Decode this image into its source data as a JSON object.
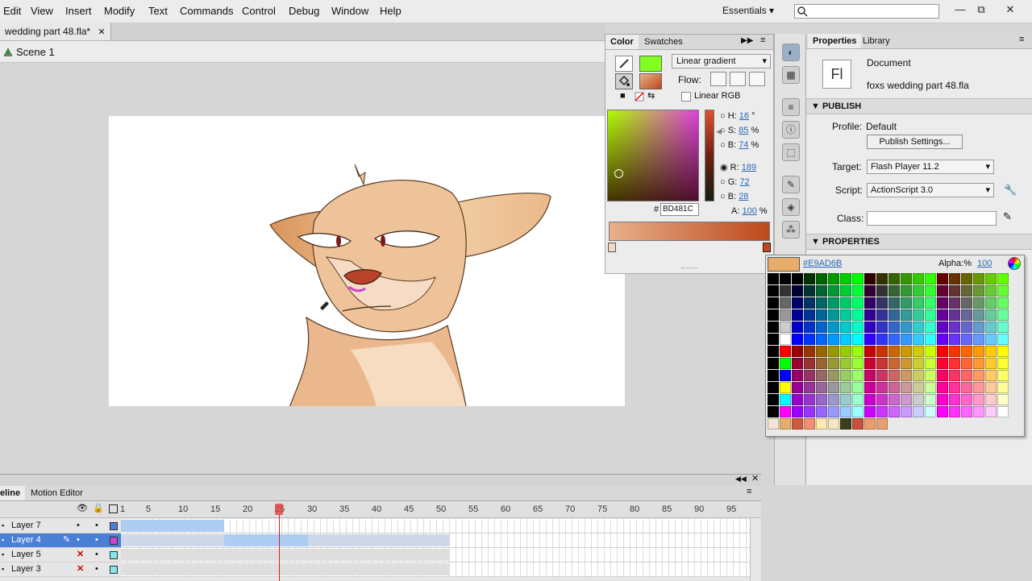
{
  "menu": {
    "items": [
      "Edit",
      "View",
      "Insert",
      "Modify",
      "Text",
      "Commands",
      "Control",
      "Debug",
      "Window",
      "Help"
    ],
    "workspace": "Essentials"
  },
  "document": {
    "tab_title": "wedding part 48.fla*",
    "scene": "Scene 1"
  },
  "color_panel": {
    "tabs": [
      "Color",
      "Swatches"
    ],
    "fill_type": "Linear gradient",
    "flow_label": "Flow:",
    "linear_rgb_label": "Linear RGB",
    "h_label": "H:",
    "h_value": "16",
    "h_unit": "°",
    "s_label": "S:",
    "s_value": "85",
    "s_unit": "%",
    "b_label": "B:",
    "b_value": "74",
    "b_unit": "%",
    "r_label": "R:",
    "r_value": "189",
    "g_label": "G:",
    "g_value": "72",
    "bb_label": "B:",
    "bb_value": "28",
    "a_label": "A:",
    "a_value": "100",
    "a_unit": "%",
    "hex_prefix": "#",
    "hex_value": "BD481C",
    "stroke_color": "#80ff20",
    "fill_gradient_start": "#e8b08a",
    "fill_gradient_end": "#bd481c"
  },
  "properties": {
    "tabs": [
      "Properties",
      "Library"
    ],
    "icon_text": "Fl",
    "doc_type": "Document",
    "doc_name": "foxs wedding part 48.fla",
    "publish_header": "PUBLISH",
    "profile_label": "Profile:",
    "profile_value": "Default",
    "publish_settings": "Publish Settings...",
    "target_label": "Target:",
    "target_value": "Flash Player 11.2",
    "script_label": "Script:",
    "script_value": "ActionScript 3.0",
    "class_label": "Class:",
    "class_value": "",
    "properties_header": "PROPERTIES"
  },
  "swatch_popup": {
    "current_hex": "#E9AD6B",
    "current_color": "#e9ad6b",
    "alpha_label": "Alpha:%",
    "alpha_value": "100",
    "custom_colors": [
      "#f4e4d4",
      "#e9ad6b",
      "#d05a3c",
      "#f09070",
      "#ffe8b0",
      "#f4e6c0",
      "#3a4018",
      "#c8503a",
      "#f09a6a",
      "#e8a070"
    ]
  },
  "timeline": {
    "tabs": [
      "eline",
      "Motion Editor"
    ],
    "frame_numbers": [
      "1",
      "5",
      "10",
      "15",
      "20",
      "25",
      "30",
      "35",
      "40",
      "45",
      "50",
      "55",
      "60",
      "65",
      "70",
      "75",
      "80",
      "85",
      "90",
      "95"
    ],
    "current_frame": "25",
    "layers": [
      {
        "name": "Layer 7",
        "selected": false,
        "hidden": false,
        "color": "#4a7fd8"
      },
      {
        "name": "Layer 4",
        "selected": true,
        "hidden": false,
        "color": "#d040d0"
      },
      {
        "name": "Layer 5",
        "selected": false,
        "hidden": true,
        "color": "#80e8e8"
      },
      {
        "name": "Layer 3",
        "selected": false,
        "hidden": true,
        "color": "#80e8e8"
      }
    ]
  }
}
